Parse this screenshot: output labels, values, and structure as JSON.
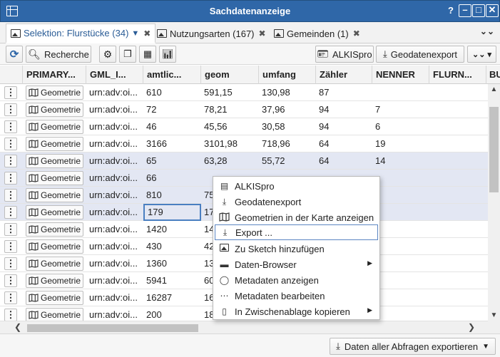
{
  "window": {
    "title": "Sachdatenanzeige",
    "help_label": "?",
    "minimize_label": "–",
    "maximize_label": "□",
    "close_label": "✕"
  },
  "tabs": [
    {
      "label": "Selektion: Flurstücke (34)",
      "active": true
    },
    {
      "label": "Nutzungsarten (167)",
      "active": false
    },
    {
      "label": "Gemeinden (1)",
      "active": false
    }
  ],
  "toolbar": {
    "search_label": "Recherche",
    "alkis_label": "ALKISpro",
    "geoexport_label": "Geodatenexport"
  },
  "table": {
    "columns": [
      "PRIMARY...",
      "GML_I...",
      "amtlic...",
      "geom",
      "umfang",
      "Zähler",
      "NENNER",
      "FLURN...",
      "BU"
    ],
    "geometry_label": "Geometrie",
    "rows": [
      {
        "gml": "urn:adv:oi...",
        "amtlich": "610",
        "geom": "591,15",
        "umfang": "130,98",
        "zaehler": "87",
        "nenner": "",
        "flurn": ""
      },
      {
        "gml": "urn:adv:oi...",
        "amtlich": "72",
        "geom": "78,21",
        "umfang": "37,96",
        "zaehler": "94",
        "nenner": "7",
        "flurn": ""
      },
      {
        "gml": "urn:adv:oi...",
        "amtlich": "46",
        "geom": "45,56",
        "umfang": "30,58",
        "zaehler": "94",
        "nenner": "6",
        "flurn": ""
      },
      {
        "gml": "urn:adv:oi...",
        "amtlich": "3166",
        "geom": "3101,98",
        "umfang": "718,96",
        "zaehler": "64",
        "nenner": "19",
        "flurn": ""
      },
      {
        "gml": "urn:adv:oi...",
        "amtlich": "65",
        "geom": "63,28",
        "umfang": "55,72",
        "zaehler": "64",
        "nenner": "14",
        "flurn": ""
      },
      {
        "gml": "urn:adv:oi...",
        "amtlich": "66",
        "geom": "",
        "umfang": "",
        "zaehler": "",
        "nenner": "",
        "flurn": ""
      },
      {
        "gml": "urn:adv:oi...",
        "amtlich": "810",
        "geom": "75",
        "umfang": "",
        "zaehler": "",
        "nenner": "",
        "flurn": ""
      },
      {
        "gml": "urn:adv:oi...",
        "amtlich": "179",
        "geom": "17",
        "umfang": "",
        "zaehler": "",
        "nenner": "",
        "flurn": ""
      },
      {
        "gml": "urn:adv:oi...",
        "amtlich": "1420",
        "geom": "14",
        "umfang": "",
        "zaehler": "",
        "nenner": "",
        "flurn": ""
      },
      {
        "gml": "urn:adv:oi...",
        "amtlich": "430",
        "geom": "42",
        "umfang": "",
        "zaehler": "",
        "nenner": "",
        "flurn": ""
      },
      {
        "gml": "urn:adv:oi...",
        "amtlich": "1360",
        "geom": "13",
        "umfang": "",
        "zaehler": "",
        "nenner": "",
        "flurn": ""
      },
      {
        "gml": "urn:adv:oi...",
        "amtlich": "5941",
        "geom": "60",
        "umfang": "",
        "zaehler": "",
        "nenner": "",
        "flurn": ""
      },
      {
        "gml": "urn:adv:oi...",
        "amtlich": "16287",
        "geom": "16",
        "umfang": "",
        "zaehler": "",
        "nenner": "",
        "flurn": ""
      },
      {
        "gml": "urn:adv:oi...",
        "amtlich": "200",
        "geom": "18",
        "umfang": "",
        "zaehler": "",
        "nenner": "",
        "flurn": ""
      }
    ]
  },
  "context_menu": {
    "items": [
      {
        "label": "ALKISpro",
        "icon": "id-card-icon",
        "submenu": false
      },
      {
        "label": "Geodatenexport",
        "icon": "download-icon",
        "submenu": false
      },
      {
        "label": "Geometrien in der Karte anzeigen",
        "icon": "map-icon",
        "submenu": false
      },
      {
        "label": "Export ...",
        "icon": "download-icon",
        "submenu": false,
        "highlighted": true
      },
      {
        "label": "Zu Sketch hinzufügen",
        "icon": "image-icon",
        "submenu": false
      },
      {
        "label": "Daten-Browser",
        "icon": "folder-icon",
        "submenu": true
      },
      {
        "label": "Metadaten anzeigen",
        "icon": "speech-bubble-icon",
        "submenu": false
      },
      {
        "label": "Metadaten bearbeiten",
        "icon": "speech-dots-icon",
        "submenu": false
      },
      {
        "label": "In Zwischenablage kopieren",
        "icon": "clipboard-icon",
        "submenu": true
      }
    ]
  },
  "footer": {
    "export_all_label": "Daten aller Abfragen exportieren"
  },
  "colors": {
    "titlebar": "#2f67a8",
    "selected_row": "#e3e7f3",
    "tab_active_text": "#2a5c96",
    "focus_border": "#4a7fc1"
  }
}
